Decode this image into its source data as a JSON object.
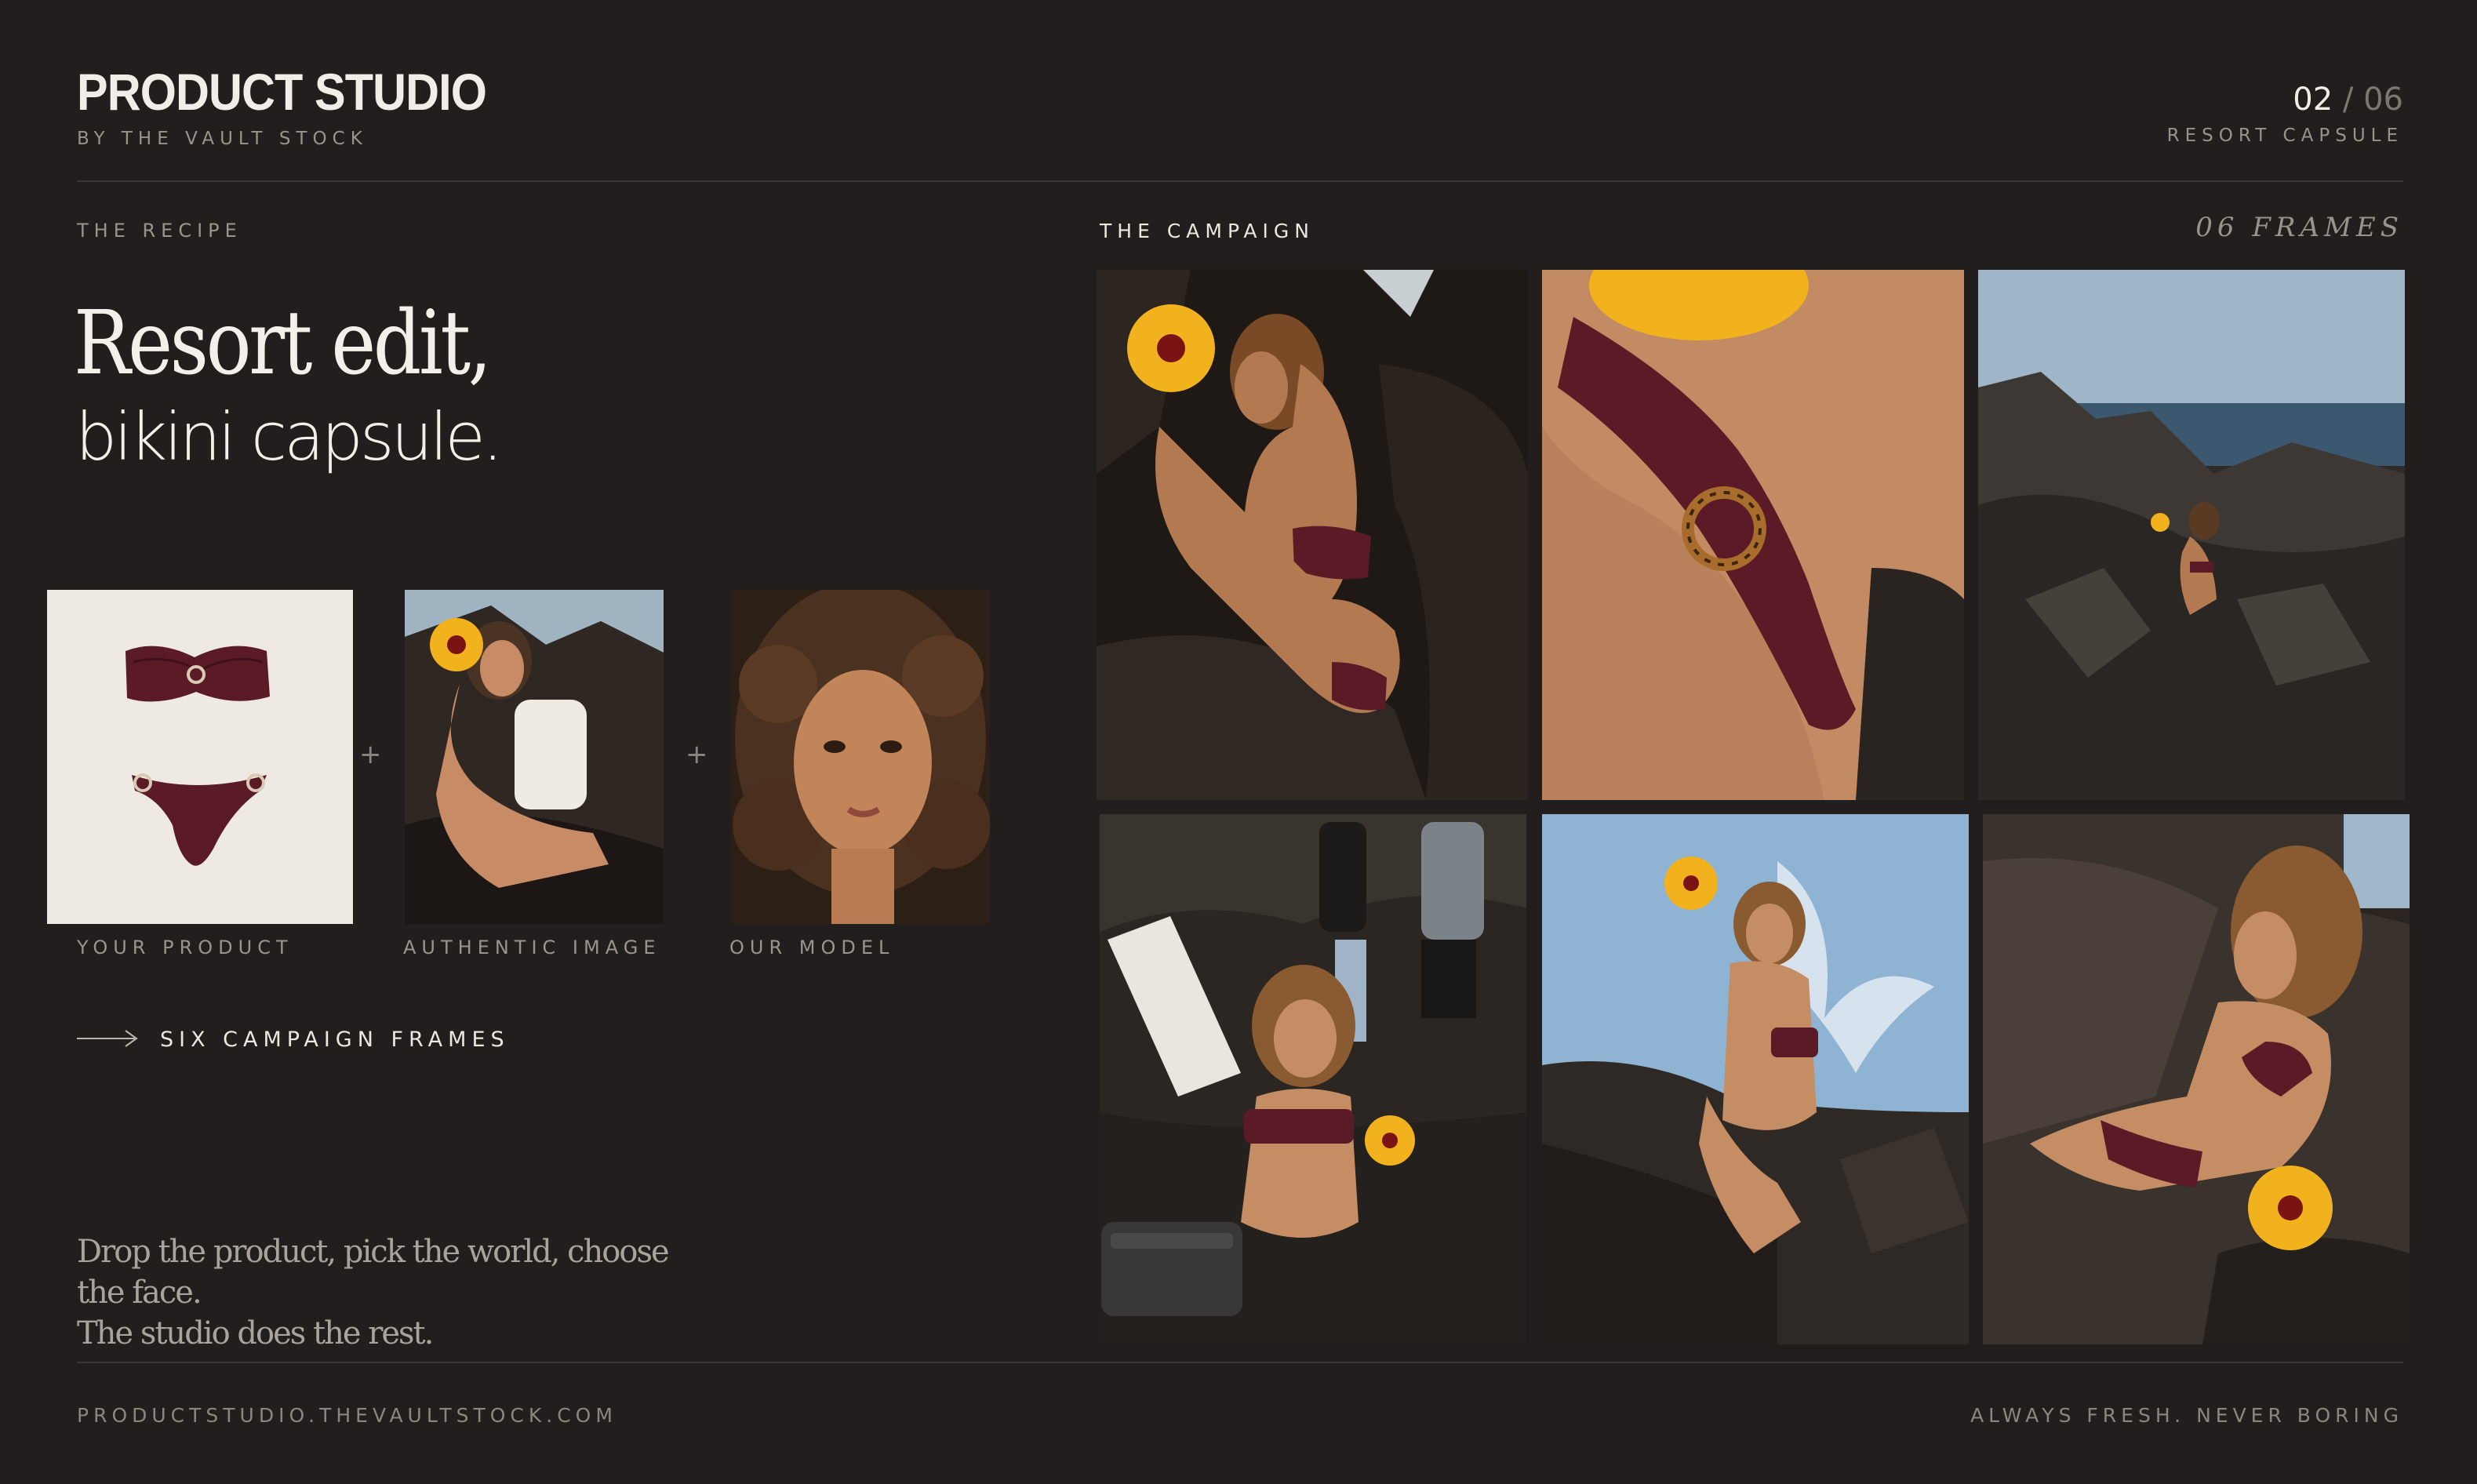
{
  "header": {
    "brand": "PRODUCT STUDIO",
    "brand_sub": "BY THE VAULT STOCK",
    "page_current": "02",
    "page_separator": "/",
    "page_total": "06",
    "collection": "RESORT CAPSULE"
  },
  "recipe": {
    "section_label": "THE RECIPE",
    "headline_line1": "Resort edit,",
    "headline_line2": "bikini capsule.",
    "inputs": [
      {
        "label": "YOUR PRODUCT",
        "subject": "burgundy bikini flat-lay"
      },
      {
        "label": "AUTHENTIC IMAGE",
        "subject": "reference pose with hibiscus"
      },
      {
        "label": "OUR MODEL",
        "subject": "model portrait"
      }
    ],
    "plus": "+",
    "cta": "SIX CAMPAIGN FRAMES",
    "tagline_line1": "Drop the product, pick the world, choose the face.",
    "tagline_line2": "The studio does the rest."
  },
  "campaign": {
    "section_label": "THE CAMPAIGN",
    "frames_count": "06 FRAMES",
    "frames": [
      {
        "subject": "crouching model with hibiscus on dark rocks"
      },
      {
        "subject": "close-up of bikini ring detail"
      },
      {
        "subject": "wide shot on coastal rocks by the sea"
      },
      {
        "subject": "behind-the-scenes shoot with crew and reflector"
      },
      {
        "subject": "seated model holding flower against sky"
      },
      {
        "subject": "reclining model on rocks with hibiscus"
      }
    ]
  },
  "footer": {
    "url": "PRODUCTSTUDIO.THEVAULTSTOCK.COM",
    "slogan": "ALWAYS FRESH. NEVER BORING"
  },
  "colors": {
    "background": "#221e1d",
    "text": "#e9e4dd",
    "muted": "#9a938c",
    "divider": "#3c3735",
    "bikini": "#5a1a26",
    "flower": "#f2b21e"
  }
}
